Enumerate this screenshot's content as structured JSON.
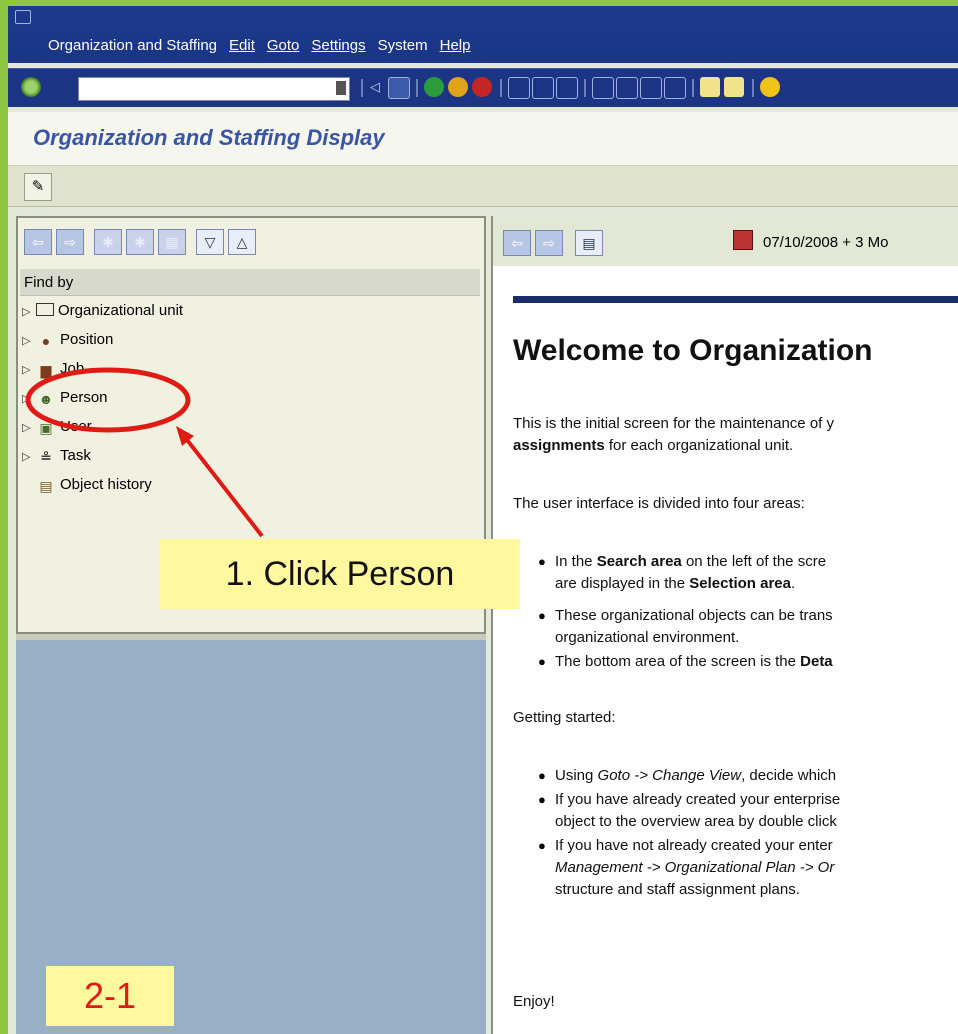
{
  "menu": {
    "items": [
      "Organization and Staffing",
      "Edit",
      "Goto",
      "Settings",
      "System",
      "Help"
    ]
  },
  "title_bar": {
    "title": "Organization and Staffing Display"
  },
  "search_area": {
    "header": "Find by",
    "tree": [
      {
        "label": "Organizational unit",
        "icon": "org-unit-icon"
      },
      {
        "label": "Position",
        "icon": "position-icon"
      },
      {
        "label": "Job",
        "icon": "job-icon"
      },
      {
        "label": "Person",
        "icon": "person-icon"
      },
      {
        "label": "User",
        "icon": "user-icon"
      },
      {
        "label": "Task",
        "icon": "task-icon"
      },
      {
        "label": "Object history",
        "icon": "object-history-icon"
      }
    ]
  },
  "detail": {
    "date": "07/10/2008",
    "period": "+ 3 Mo",
    "welcome": "Welcome to Organization",
    "intro_1": "This is the initial screen for the maintenance of y",
    "intro_2_bold": "assignments",
    "intro_2_rest": " for each organizational unit.",
    "areas_intro": "The user interface is divided into four areas:",
    "bullets_1": [
      {
        "pre": "In the ",
        "bold": "Search area",
        "post": " on the left of the scre"
      },
      {
        "pre": "are displayed in the ",
        "bold": "Selection area",
        "post": "."
      },
      {
        "pre": "These organizational objects can be trans",
        "bold": "",
        "post": ""
      },
      {
        "pre": "organizational environment.",
        "bold": "",
        "post": ""
      },
      {
        "pre": "The bottom area of the screen is the ",
        "bold": "Deta",
        "post": ""
      }
    ],
    "getting_started": "Getting started:",
    "bullets_2": [
      {
        "pre": "Using ",
        "italic": "Goto -> Change View",
        "post": ", decide which"
      },
      {
        "pre": "If you have already created your enterprise",
        "italic": "",
        "post": ""
      },
      {
        "pre": "object to the overview area by double click",
        "italic": "",
        "post": ""
      },
      {
        "pre": "If you have not already created your enter",
        "italic": "",
        "post": ""
      },
      {
        "pre": "",
        "italic": "Management -> Organizational Plan -> Or",
        "post": ""
      },
      {
        "pre": "structure and staff assignment plans.",
        "italic": "",
        "post": ""
      }
    ],
    "enjoy": "Enjoy!"
  },
  "annotations": {
    "callout": "1. Click Person",
    "step": "2-1",
    "highlight_color": "#e01b14",
    "callout_bg": "#fff89e"
  }
}
